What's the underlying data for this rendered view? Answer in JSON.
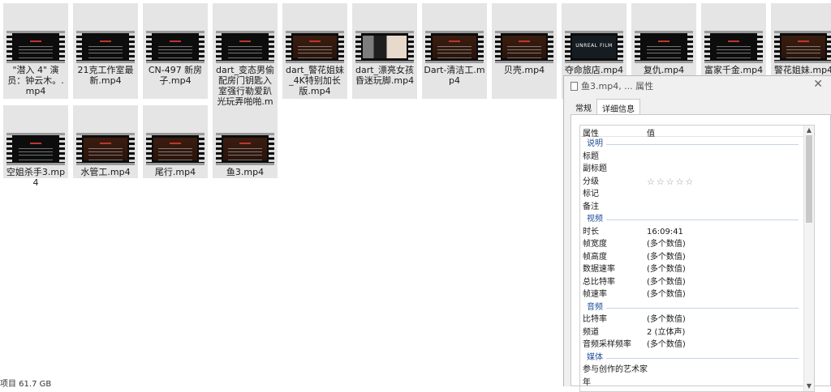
{
  "files": [
    {
      "name": "\"潜入 4\" 演员：钟云木。.mp4",
      "thumb": "dark"
    },
    {
      "name": "21克工作室最新.mp4",
      "thumb": "dark"
    },
    {
      "name": "CN-497 新房子.mp4",
      "thumb": "dark"
    },
    {
      "name": "dart_变态男偷配房门钥匙入室强行勒爱趴光玩弄啪啪.mp4",
      "thumb": "dark"
    },
    {
      "name": "dart_警花姐妹_4K特别加长版.mp4",
      "thumb": "brown"
    },
    {
      "name": "dart_漂亮女孩昏迷玩脚.mp4",
      "thumb": "photo"
    },
    {
      "name": "Dart-清洁工.mp4",
      "thumb": "brown"
    },
    {
      "name": "贝壳.mp4",
      "thumb": "brown"
    },
    {
      "name": "夺命旅店.mp4",
      "thumb": "unreal",
      "thumb_text": "UNREAL FILM"
    },
    {
      "name": "复仇.mp4",
      "thumb": "dark"
    },
    {
      "name": "富家千金.mp4",
      "thumb": "dark"
    },
    {
      "name": "警花姐妹.mp4",
      "thumb": "brown"
    },
    {
      "name": "空姐杀手3.mp4",
      "thumb": "dark"
    },
    {
      "name": "水管工.mp4",
      "thumb": "brown"
    },
    {
      "name": "尾行.mp4",
      "thumb": "brown"
    },
    {
      "name": "鱼3.mp4",
      "thumb": "brown"
    }
  ],
  "status_bar": {
    "text": "项目  61.7 GB"
  },
  "dialog": {
    "title": "鱼3.mp4, ... 属性",
    "close_glyph": "✕",
    "tabs": [
      "常规",
      "详细信息"
    ],
    "active_tab": "详细信息",
    "columns": {
      "property": "属性",
      "value": "值"
    },
    "rows": [
      {
        "type": "section",
        "label": "说明"
      },
      {
        "key": "标题",
        "value": ""
      },
      {
        "key": "副标题",
        "value": ""
      },
      {
        "key": "分级",
        "value": "☆☆☆☆☆",
        "rating_stars": 0
      },
      {
        "key": "标记",
        "value": ""
      },
      {
        "key": "备注",
        "value": ""
      },
      {
        "type": "section",
        "label": "视频"
      },
      {
        "key": "时长",
        "value": "16:09:41"
      },
      {
        "key": "帧宽度",
        "value": "(多个数值)"
      },
      {
        "key": "帧高度",
        "value": "(多个数值)"
      },
      {
        "key": "数据速率",
        "value": "(多个数值)"
      },
      {
        "key": "总比特率",
        "value": "(多个数值)"
      },
      {
        "key": "帧速率",
        "value": "(多个数值)"
      },
      {
        "type": "section",
        "label": "音频"
      },
      {
        "key": "比特率",
        "value": "(多个数值)"
      },
      {
        "key": "频道",
        "value": "2 (立体声)"
      },
      {
        "key": "音频采样频率",
        "value": "(多个数值)"
      },
      {
        "type": "section",
        "label": "媒体"
      },
      {
        "key": "参与创作的艺术家",
        "value": ""
      },
      {
        "key": "年",
        "value": ""
      }
    ],
    "scroll_up_glyph": "▲",
    "scroll_down_glyph": "▼"
  },
  "colors": {
    "tile_bg": "#e5e5e5",
    "section_text": "#1f4d9a",
    "dialog_bg": "#f0f0f0"
  }
}
